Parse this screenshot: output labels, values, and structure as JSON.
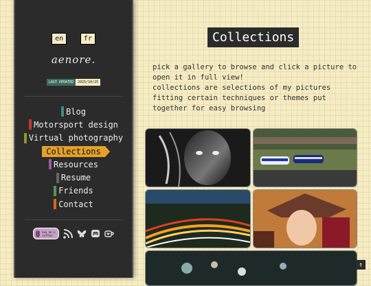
{
  "lang": [
    "en",
    "fr"
  ],
  "logo": "aenore.",
  "last_updated": {
    "label": "LAST UPDATED",
    "date": "2025/10/25"
  },
  "nav": [
    {
      "label": "Blog",
      "color": "#3c8a8a",
      "active": false
    },
    {
      "label": "Motorsport design",
      "color": "#c0392b",
      "active": false
    },
    {
      "label": "Virtual photography",
      "color": "#8a9a2a",
      "active": false
    },
    {
      "label": "Collections",
      "color": "#e3a12a",
      "active": true
    },
    {
      "label": "Resources",
      "color": "#a05a9a",
      "active": false
    },
    {
      "label": "Resume",
      "color": "#666666",
      "active": false
    },
    {
      "label": "Friends",
      "color": "#4a9a5a",
      "active": false
    },
    {
      "label": "Contact",
      "color": "#d9661a",
      "active": false
    }
  ],
  "kofi": "buy me a coffee!",
  "social_icons": [
    "rss-icon",
    "bluesky-icon",
    "mastodon-icon",
    "kofi-cup-icon"
  ],
  "title": "Collections",
  "description": [
    "pick a gallery to browse and click a picture to open it in full view!",
    "collections are selections of my pictures fitting certain techniques or themes put together for easy browsing"
  ],
  "gallery": [
    "bw-portrait",
    "race-cars-track",
    "night-light-trails",
    "character-portrait",
    "blurred-track"
  ],
  "scroll_top": "↑"
}
